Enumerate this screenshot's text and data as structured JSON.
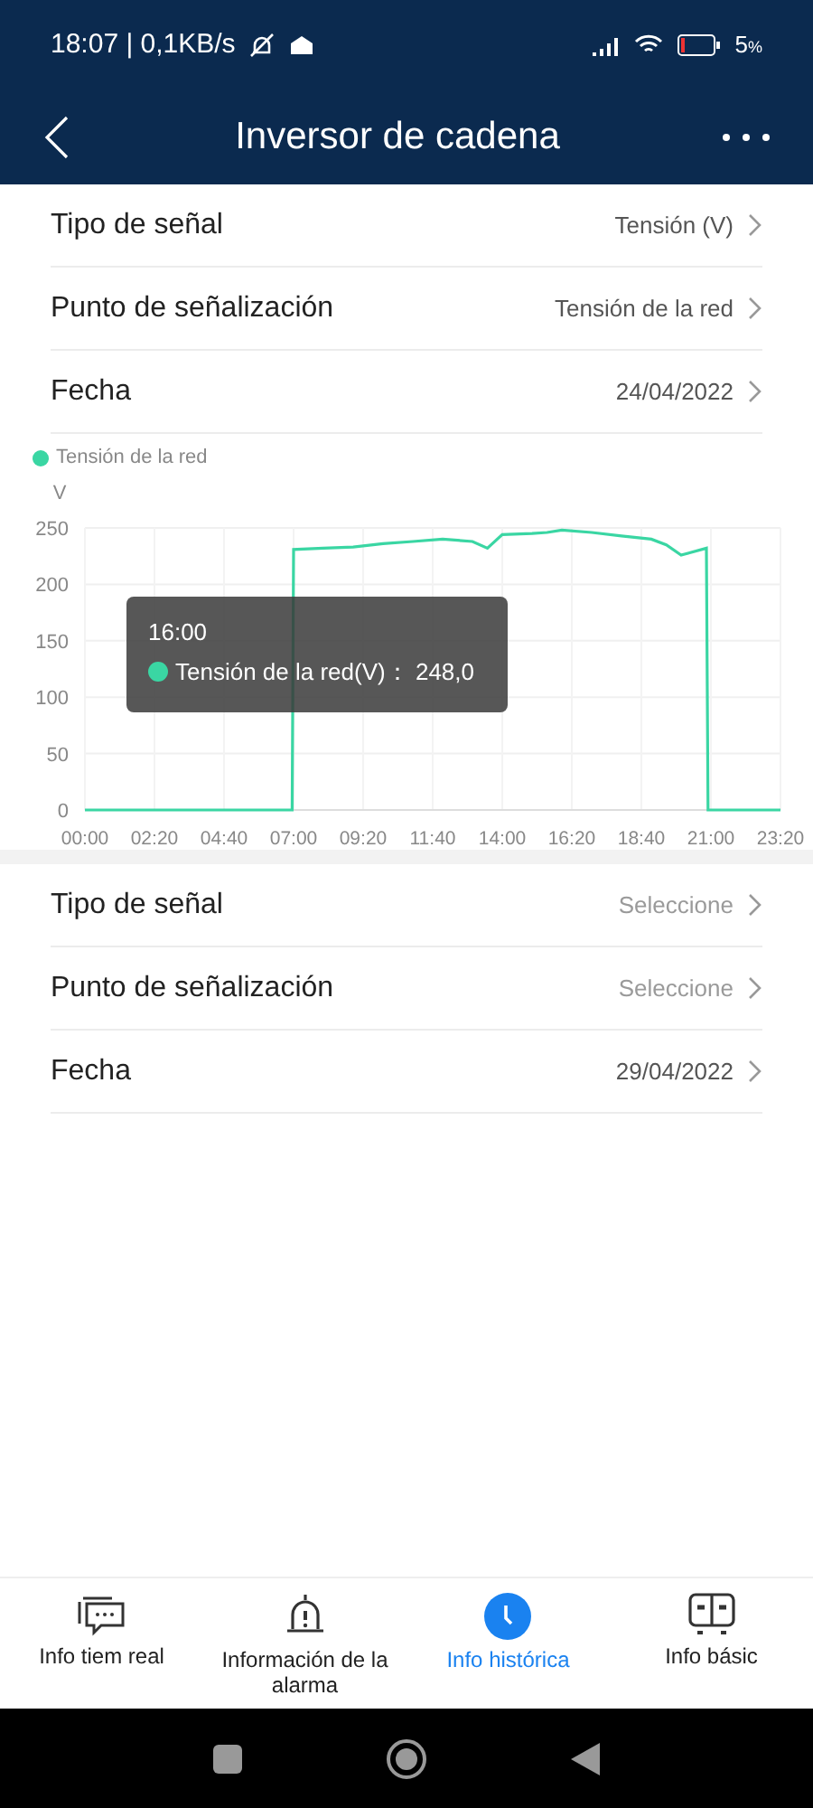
{
  "status_bar": {
    "time": "18:07 | 0,1KB/s",
    "battery": "5",
    "battery_unit": "%"
  },
  "header": {
    "title": "Inversor de cadena"
  },
  "top_settings": [
    {
      "label": "Tipo de señal",
      "value": "Tensión (V)",
      "placeholder_style": false
    },
    {
      "label": "Punto de señalización",
      "value": "Tensión de la red",
      "placeholder_style": false
    },
    {
      "label": "Fecha",
      "value": "24/04/2022",
      "placeholder_style": false
    }
  ],
  "chart": {
    "tooltip": {
      "time": "16:00",
      "label": "Tensión de la red(V)：",
      "value": "248,0"
    },
    "chart_data": {
      "type": "line",
      "ylabel": "V",
      "xlim": [
        0,
        23.333
      ],
      "ylim": [
        0,
        250
      ],
      "grid": true,
      "yticks": [
        0,
        50,
        100,
        150,
        200,
        250
      ],
      "xticks": [
        {
          "value": 0,
          "label": "00:00"
        },
        {
          "value": 2.333,
          "label": "02:20"
        },
        {
          "value": 4.667,
          "label": "04:40"
        },
        {
          "value": 7,
          "label": "07:00"
        },
        {
          "value": 9.333,
          "label": "09:20"
        },
        {
          "value": 11.667,
          "label": "11:40"
        },
        {
          "value": 14,
          "label": "14:00"
        },
        {
          "value": 16.333,
          "label": "16:20"
        },
        {
          "value": 18.667,
          "label": "18:40"
        },
        {
          "value": 21,
          "label": "21:00"
        },
        {
          "value": 23.333,
          "label": "23:20"
        }
      ],
      "x": [
        0,
        6.95,
        7.0,
        8,
        9,
        10,
        11,
        12,
        13,
        13.5,
        14,
        15,
        15.5,
        16,
        17,
        18,
        19,
        19.5,
        20,
        20.85,
        20.9,
        23.333
      ],
      "series": [
        {
          "name": "Tensión de la red",
          "color": "#3ad6a3",
          "values": [
            0,
            0,
            231,
            232,
            233,
            236,
            238,
            240,
            238,
            232,
            244,
            245,
            246,
            248,
            246,
            243,
            240,
            235,
            226,
            232,
            0,
            0
          ]
        }
      ]
    }
  },
  "bottom_settings": [
    {
      "label": "Tipo de señal",
      "value": "Seleccione",
      "placeholder_style": true
    },
    {
      "label": "Punto de señalización",
      "value": "Seleccione",
      "placeholder_style": true
    },
    {
      "label": "Fecha",
      "value": "29/04/2022",
      "placeholder_style": false
    }
  ],
  "tabs": [
    {
      "label": "Info tiem real",
      "kind": "chat",
      "selected": false
    },
    {
      "label": "Información de la alarma",
      "kind": "alarm",
      "selected": false
    },
    {
      "label": "Info histórica",
      "kind": "clock",
      "selected": true
    },
    {
      "label": "Info básic",
      "kind": "device",
      "selected": false
    }
  ]
}
